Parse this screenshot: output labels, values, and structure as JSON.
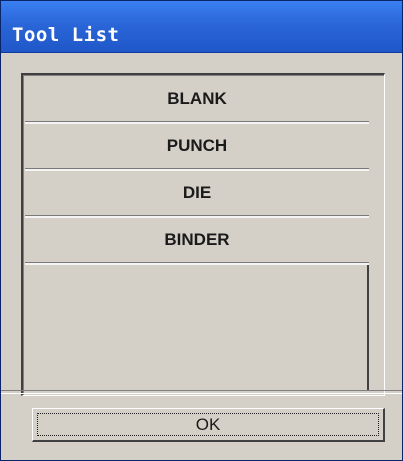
{
  "window": {
    "title": "Tool List"
  },
  "list": {
    "items": [
      {
        "label": "BLANK"
      },
      {
        "label": "PUNCH"
      },
      {
        "label": "DIE"
      },
      {
        "label": "BINDER"
      }
    ]
  },
  "buttons": {
    "ok_label": "OK"
  },
  "colors": {
    "titlebar": "#2a66d8",
    "title_text": "#ffffff",
    "face": "#d4d0c8"
  }
}
